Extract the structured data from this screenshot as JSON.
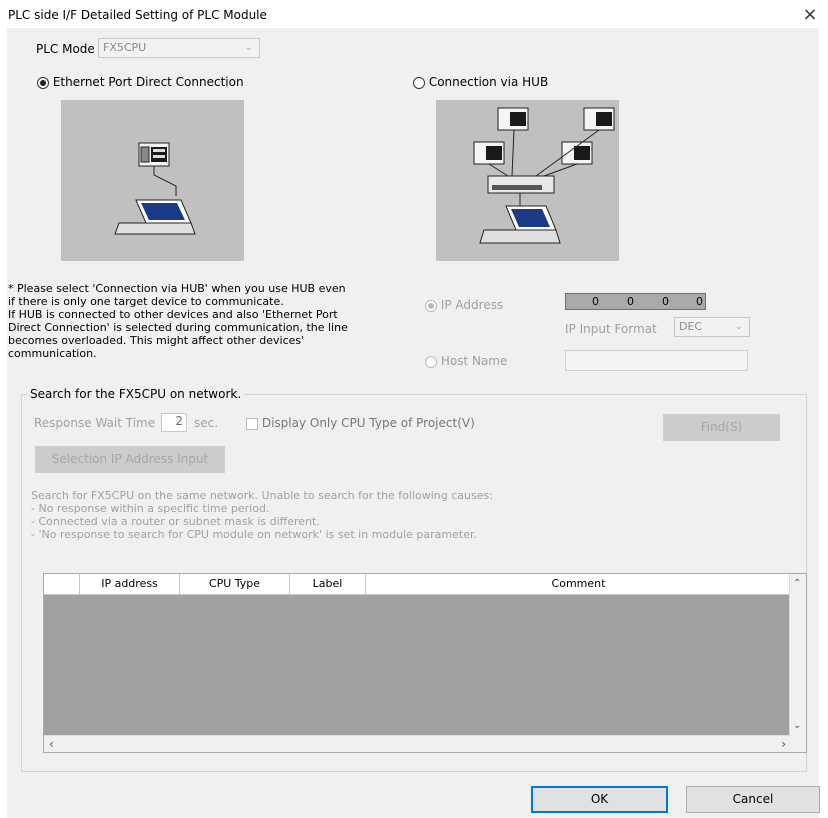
{
  "window": {
    "title": "PLC side I/F Detailed Setting of PLC Module",
    "close_glyph": "×"
  },
  "plc_mode": {
    "label": "PLC Mode",
    "value": "FX5CPU"
  },
  "connection": {
    "direct_label": "Ethernet Port Direct Connection",
    "hub_label": "Connection via HUB",
    "selected": "direct"
  },
  "note_lines": [
    "* Please select 'Connection via HUB' when you use HUB even",
    "if there is only one target device to communicate.",
    "If HUB is connected to other devices and also 'Ethernet Port",
    "Direct Connection' is selected during communication, the line",
    "becomes overloaded. This might affect other devices'",
    "communication."
  ],
  "address": {
    "ip_label": "IP Address",
    "ip_octets": [
      "0",
      "0",
      "0",
      "0"
    ],
    "format_label": "IP Input Format",
    "format_value": "DEC",
    "host_label": "Host Name",
    "host_value": ""
  },
  "search": {
    "group_title": "Search for the FX5CPU on network.",
    "wait_label": "Response Wait Time",
    "wait_value": "2",
    "wait_unit": "sec.",
    "display_only_label": "Display Only CPU Type of Project(V)",
    "find_button": "Find(S)",
    "selection_button": "Selection IP Address Input",
    "info_lines": [
      "Search for FX5CPU on the same network. Unable to search for the following causes:",
      "- No response within a specific time period.",
      "- Connected via a router or subnet mask is different.",
      "- 'No response to search for CPU module on network' is set in module parameter."
    ]
  },
  "table": {
    "columns": [
      "IP address",
      "CPU Type",
      "Label",
      "Comment"
    ],
    "rows": []
  },
  "buttons": {
    "ok": "OK",
    "cancel": "Cancel"
  },
  "icons": [
    "close-icon",
    "chevron-down-icon",
    "plc-icon",
    "laptop-icon",
    "hub-icon",
    "scroll-up-icon",
    "scroll-down-icon",
    "scroll-left-icon",
    "scroll-right-icon"
  ],
  "colors": {
    "dialog_bg": "#f0f0f0",
    "image_bg": "#c0c0c0",
    "default_button_border": "#0078d7"
  }
}
